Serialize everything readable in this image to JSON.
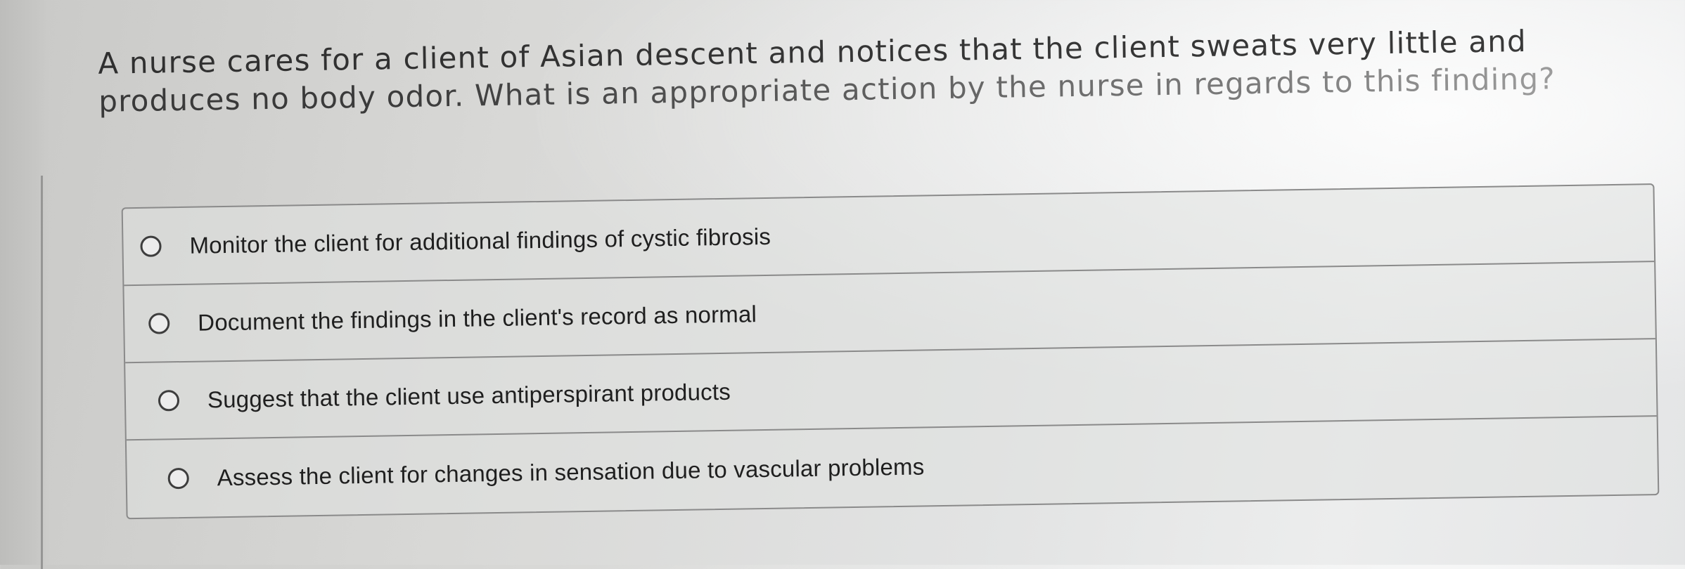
{
  "question": {
    "text": "A nurse cares for a client of Asian descent and notices that the client sweats very little and produces no body odor. What is an appropriate action by the nurse in regards to this finding?"
  },
  "options": [
    {
      "label": "Monitor the client for additional findings of cystic fibrosis",
      "selected": false
    },
    {
      "label": "Document the findings in the client's record as normal",
      "selected": false
    },
    {
      "label": "Suggest that the client use antiperspirant products",
      "selected": false
    },
    {
      "label": "Assess the client for changes in sensation due to vascular problems",
      "selected": false
    }
  ]
}
